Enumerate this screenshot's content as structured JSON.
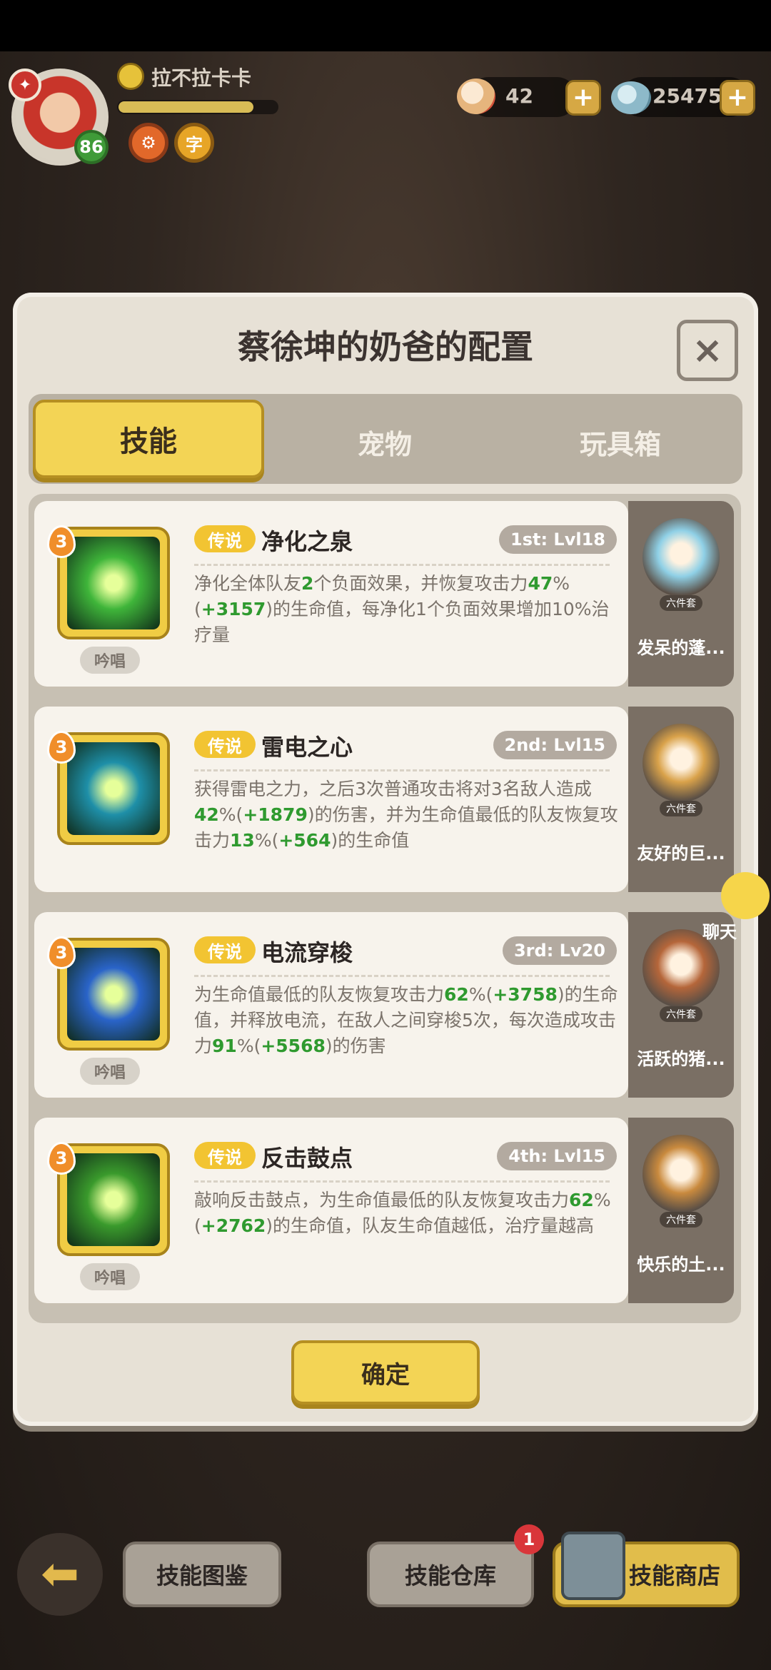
{
  "player": {
    "name": "拉不拉卡卡",
    "level": "86",
    "xp_fraction": 0.85,
    "avatar_badge_icon": "helmet-icon"
  },
  "currency": {
    "shells": "42",
    "gems": "254754"
  },
  "dialog": {
    "title": "蔡徐坤的奶爸的配置",
    "close_label": "×",
    "tabs": [
      "技能",
      "宠物",
      "玩具箱"
    ],
    "active_tab": 0,
    "confirm_label": "确定"
  },
  "skills": [
    {
      "rarity": "传说",
      "name": "净化之泉",
      "slot": "1st: Lvl18",
      "level": "3",
      "chant": "吟唱",
      "desc_parts": [
        {
          "t": "净化全体队友"
        },
        {
          "t": "2",
          "g": true
        },
        {
          "t": "个负面效果，并恢复攻击力"
        },
        {
          "t": "47",
          "g": true
        },
        {
          "t": "%("
        },
        {
          "t": "+3157",
          "g": true
        },
        {
          "t": ")的生命值，每净化1个负面效果增加10%治疗量"
        }
      ],
      "pet_name": "发呆的蓬...",
      "pet_tag": "六件套",
      "art_color": "#3fb53a",
      "pet_color": "#8fd0e6"
    },
    {
      "rarity": "传说",
      "name": "雷电之心",
      "slot": "2nd: Lvl15",
      "level": "3",
      "chant": "",
      "desc_parts": [
        {
          "t": "获得雷电之力，之后3次普通攻击将对3名敌人造成"
        },
        {
          "t": "42",
          "g": true
        },
        {
          "t": "%("
        },
        {
          "t": "+1879",
          "g": true
        },
        {
          "t": ")的伤害，并为生命值最低的队友恢复攻击力"
        },
        {
          "t": "13",
          "g": true
        },
        {
          "t": "%("
        },
        {
          "t": "+564",
          "g": true
        },
        {
          "t": ")的生命值"
        }
      ],
      "pet_name": "友好的巨...",
      "pet_tag": "六件套",
      "art_color": "#1e8fa8",
      "pet_color": "#d9a24a"
    },
    {
      "rarity": "传说",
      "name": "电流穿梭",
      "slot": "3rd: Lv20",
      "level": "3",
      "chant": "吟唱",
      "desc_parts": [
        {
          "t": "为生命值最低的队友恢复攻击力"
        },
        {
          "t": "62",
          "g": true
        },
        {
          "t": "%("
        },
        {
          "t": "+3758",
          "g": true
        },
        {
          "t": ")的生命值，并释放电流，在敌人之间穿梭5次，每次造成攻击力"
        },
        {
          "t": "91",
          "g": true
        },
        {
          "t": "%("
        },
        {
          "t": "+5568",
          "g": true
        },
        {
          "t": ")的伤害"
        }
      ],
      "pet_name": "活跃的猪...",
      "pet_tag": "六件套",
      "art_color": "#2a64c9",
      "pet_color": "#b5663a"
    },
    {
      "rarity": "传说",
      "name": "反击鼓点",
      "slot": "4th: Lvl15",
      "level": "3",
      "chant": "吟唱",
      "desc_parts": [
        {
          "t": "敲响反击鼓点，为生命值最低的队友恢复攻击力"
        },
        {
          "t": "62",
          "g": true
        },
        {
          "t": "%("
        },
        {
          "t": "+2762",
          "g": true
        },
        {
          "t": ")的生命值，队友生命值越低，治疗量越高"
        }
      ],
      "pet_name": "快乐的土...",
      "pet_tag": "六件套",
      "art_color": "#3a9a2c",
      "pet_color": "#c98a3e"
    }
  ],
  "chat": {
    "label": "聊天"
  },
  "bottom": {
    "codex_label": "技能图鉴",
    "storage_label": "技能仓库",
    "storage_badge": "1",
    "shop_label": "技能商店"
  }
}
